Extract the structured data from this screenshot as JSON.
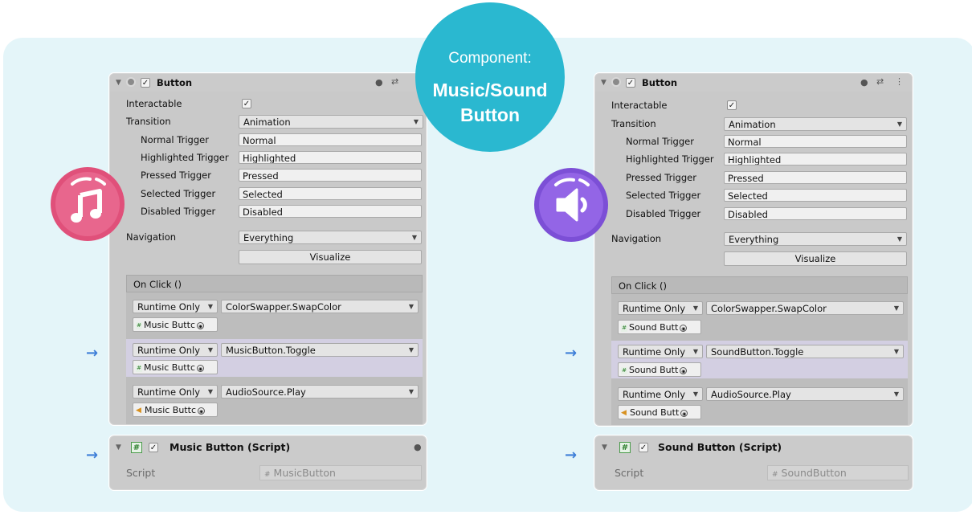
{
  "badge": {
    "line1": "Component:",
    "line2a": "Music/Sound",
    "line2b": "Button"
  },
  "colors": {
    "accent": "#2ab8d0",
    "music_icon": "#e0507a",
    "sound_icon": "#8b5ce0",
    "arrow": "#3f7fd8",
    "background": "#e4f5f9"
  },
  "left": {
    "header_title": "Button",
    "interactable_label": "Interactable",
    "interactable_check": "✓",
    "transition_label": "Transition",
    "transition_value": "Animation",
    "triggers": [
      {
        "label": "Normal Trigger",
        "value": "Normal"
      },
      {
        "label": "Highlighted Trigger",
        "value": "Highlighted"
      },
      {
        "label": "Pressed Trigger",
        "value": "Pressed"
      },
      {
        "label": "Selected Trigger",
        "value": "Selected"
      },
      {
        "label": "Disabled Trigger",
        "value": "Disabled"
      }
    ],
    "navigation_label": "Navigation",
    "navigation_value": "Everything",
    "visualize_label": "Visualize",
    "onclick_label": "On Click ()",
    "entries": [
      {
        "mode": "Runtime Only",
        "function": "ColorSwapper.SwapColor",
        "object": "Music Buttc"
      },
      {
        "mode": "Runtime Only",
        "function": "MusicButton.Toggle",
        "object": "Music Buttc"
      },
      {
        "mode": "Runtime Only",
        "function": "AudioSource.Play",
        "object": "Music Buttc"
      }
    ],
    "script_title": "Music Button (Script)",
    "script_label": "Script",
    "script_value": "MusicButton",
    "icon": "music-note-icon"
  },
  "right": {
    "header_title": "Button",
    "interactable_label": "Interactable",
    "interactable_check": "✓",
    "transition_label": "Transition",
    "transition_value": "Animation",
    "triggers": [
      {
        "label": "Normal Trigger",
        "value": "Normal"
      },
      {
        "label": "Highlighted Trigger",
        "value": "Highlighted"
      },
      {
        "label": "Pressed Trigger",
        "value": "Pressed"
      },
      {
        "label": "Selected Trigger",
        "value": "Selected"
      },
      {
        "label": "Disabled Trigger",
        "value": "Disabled"
      }
    ],
    "navigation_label": "Navigation",
    "navigation_value": "Everything",
    "visualize_label": "Visualize",
    "onclick_label": "On Click ()",
    "entries": [
      {
        "mode": "Runtime Only",
        "function": "ColorSwapper.SwapColor",
        "object": "Sound Butt"
      },
      {
        "mode": "Runtime Only",
        "function": "SoundButton.Toggle",
        "object": "Sound Butt"
      },
      {
        "mode": "Runtime Only",
        "function": "AudioSource.Play",
        "object": "Sound Butt"
      }
    ],
    "script_title": "Sound Button (Script)",
    "script_label": "Script",
    "script_value": "SoundButton",
    "icon": "speaker-icon"
  }
}
